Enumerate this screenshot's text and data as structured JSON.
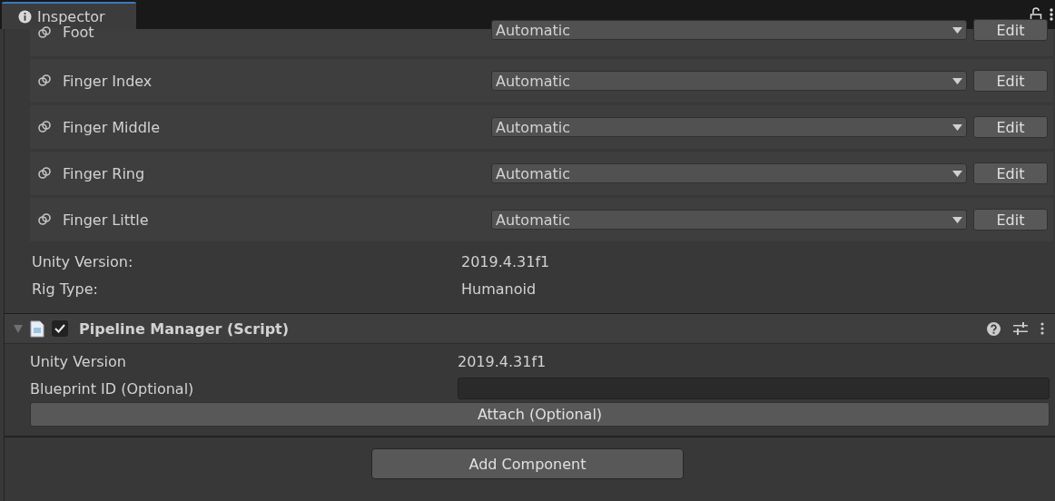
{
  "tab": {
    "title": "Inspector",
    "selected": true
  },
  "bones": [
    {
      "label": "Foot",
      "value": "Automatic",
      "button": "Edit"
    },
    {
      "label": "Finger Index",
      "value": "Automatic",
      "button": "Edit"
    },
    {
      "label": "Finger Middle",
      "value": "Automatic",
      "button": "Edit"
    },
    {
      "label": "Finger Ring",
      "value": "Automatic",
      "button": "Edit"
    },
    {
      "label": "Finger Little",
      "value": "Automatic",
      "button": "Edit"
    }
  ],
  "info": [
    {
      "label": "Unity Version:",
      "value": "2019.4.31f1"
    },
    {
      "label": "Rig Type:",
      "value": "Humanoid"
    }
  ],
  "component": {
    "title": "Pipeline Manager (Script)",
    "enabled": true,
    "expanded": true,
    "version": {
      "label": "Unity Version",
      "value": "2019.4.31f1"
    },
    "blueprint": {
      "label": "Blueprint ID (Optional)"
    },
    "attach": "Attach (Optional)"
  },
  "add_button": "Add Component"
}
